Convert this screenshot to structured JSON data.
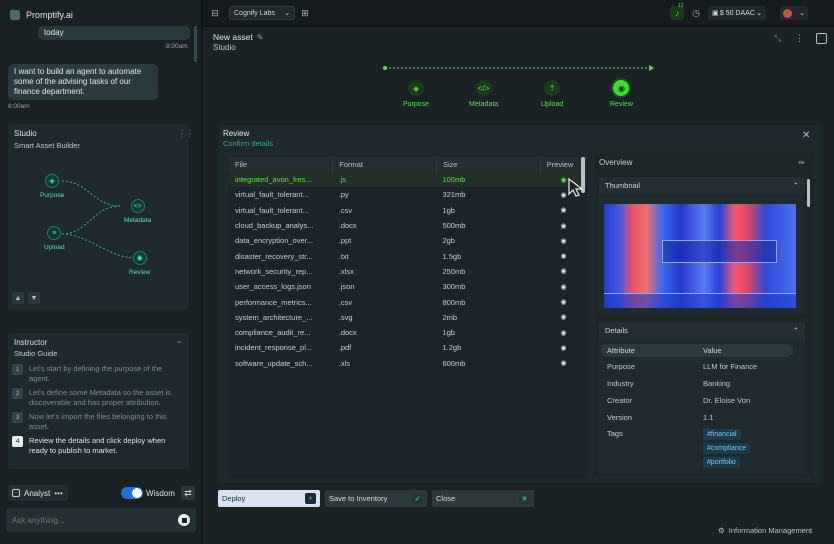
{
  "app": {
    "name": "Promptify.ai"
  },
  "chat": {
    "prev_text": "today",
    "prev_time": "8:00am",
    "user_msg": "I want to build an agent to automate some of the advising tasks of our finance department.",
    "user_time": "8:00am"
  },
  "studio_card": {
    "title": "Studio",
    "subtitle": "Smart Asset Builder",
    "nodes": [
      "Purpose",
      "Upload",
      "Metadata",
      "Review"
    ]
  },
  "instructor": {
    "title": "Instructor",
    "subtitle": "Studio Guide",
    "steps": [
      {
        "num": "1",
        "text": "Let's start by defining the purpose of the agent."
      },
      {
        "num": "2",
        "text": "Let's define some Metadata so the asset is discoverable and has proper attribution."
      },
      {
        "num": "3",
        "text": "Now let's import the files belonging to this asset."
      },
      {
        "num": "4",
        "text": "Review the details and click deploy when ready to publish to market."
      }
    ]
  },
  "bottom_bar": {
    "agent": "Analyst",
    "wisdom": "Wisdom",
    "placeholder": "Ask anything..."
  },
  "topbar": {
    "org": "Cognify Labs",
    "notif_count": "12",
    "balance": "$ 50 DAAC"
  },
  "asset": {
    "title": "New asset",
    "subtitle": "Studio"
  },
  "steps": [
    "Purpose",
    "Metadata",
    "Upload",
    "Review"
  ],
  "review": {
    "title": "Review",
    "subtitle": "Confirm details",
    "columns": [
      "File",
      "Format",
      "Size",
      "Preview"
    ],
    "files": [
      {
        "name": "integrated_avon_fres...",
        "format": ".js",
        "size": "100mb"
      },
      {
        "name": "virtual_fault_tolerant...",
        "format": ".py",
        "size": "321mb"
      },
      {
        "name": "virtual_fault_tolerant...",
        "format": ".csv",
        "size": "1gb"
      },
      {
        "name": "cloud_backup_analys...",
        "format": ".docx",
        "size": "500mb"
      },
      {
        "name": "data_encryption_over...",
        "format": ".ppt",
        "size": "2gb"
      },
      {
        "name": "disaster_recovery_str...",
        "format": ".txt",
        "size": "1.5gb"
      },
      {
        "name": "network_security_rep...",
        "format": ".xlsx",
        "size": "250mb"
      },
      {
        "name": "user_access_logs.json",
        "format": ".json",
        "size": "300mb"
      },
      {
        "name": "performance_metrics...",
        "format": ".csv",
        "size": "800mb"
      },
      {
        "name": "system_architecture_...",
        "format": ".svg",
        "size": "2mb"
      },
      {
        "name": "compliance_audit_re...",
        "format": ".docx",
        "size": "1gb"
      },
      {
        "name": "incident_response_pl...",
        "format": ".pdf",
        "size": "1.2gb"
      },
      {
        "name": "software_update_sch...",
        "format": ".xls",
        "size": "600mb"
      }
    ],
    "overview": "Overview",
    "thumbnail": "Thumbnail",
    "details": {
      "title": "Details",
      "col_attr": "Attribute",
      "col_val": "Value",
      "rows": [
        {
          "k": "Purpose",
          "v": "LLM for Finance"
        },
        {
          "k": "Industry",
          "v": "Banking"
        },
        {
          "k": "Creator",
          "v": "Dr. Eloise Von"
        },
        {
          "k": "Version",
          "v": "1.1"
        }
      ],
      "tags_label": "Tags",
      "tags": [
        "#financial",
        "#compliance",
        "#portfolio"
      ]
    }
  },
  "actions": {
    "deploy": "Deploy",
    "save": "Save to Inventory",
    "close": "Close"
  },
  "footer": {
    "info": "Information Management"
  },
  "colors": {
    "accent_green": "#54e049",
    "teal": "#56e0c6"
  }
}
